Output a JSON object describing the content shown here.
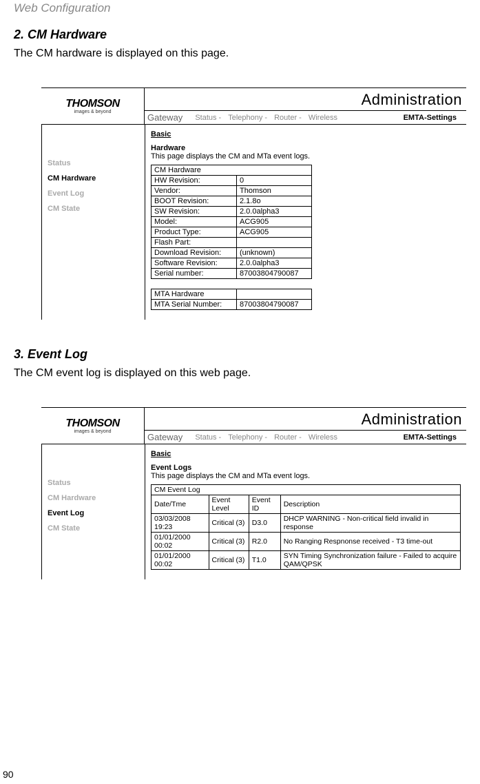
{
  "header": "Web Configuration",
  "page_number": "90",
  "section2": {
    "heading": "2. CM Hardware",
    "text": "The CM hardware is displayed on this page."
  },
  "section3": {
    "heading": "3. Event Log",
    "text": "The CM event log is displayed on this web page."
  },
  "logo": {
    "main": "THOMSON",
    "sub": "images & beyond"
  },
  "admin_title": "Administration",
  "nav": {
    "gateway": "Gateway",
    "status": "Status -",
    "telephony": "Telephony -",
    "router": "Router -",
    "wireless": "Wireless",
    "emta": "EMTA-Settings"
  },
  "side": {
    "status": "Status",
    "cm_hardware": "CM Hardware",
    "event_log": "Event Log",
    "cm_state": "CM State"
  },
  "hw_panel": {
    "basic": "Basic",
    "title": "Hardware",
    "desc": "This page displays the CM and MTa event logs.",
    "table_header": "CM Hardware",
    "rows": [
      {
        "label": "HW Revision:",
        "value": "0"
      },
      {
        "label": "Vendor:",
        "value": "Thomson"
      },
      {
        "label": "BOOT Revision:",
        "value": "2.1.8o"
      },
      {
        "label": "SW Revision:",
        "value": "2.0.0alpha3"
      },
      {
        "label": "Model:",
        "value": "ACG905"
      },
      {
        "label": "Product Type:",
        "value": "ACG905"
      },
      {
        "label": "Flash Part:",
        "value": ""
      },
      {
        "label": "Download Revision:",
        "value": "(unknown)"
      },
      {
        "label": "Software Revision:",
        "value": "2.0.0alpha3"
      },
      {
        "label": "Serial number:",
        "value": "87003804790087"
      }
    ],
    "mta_header": "MTA Hardware",
    "mta_row": {
      "label": "MTA Serial Number:",
      "value": "87003804790087"
    }
  },
  "ev_panel": {
    "basic": "Basic",
    "title": "Event Logs",
    "desc": "This page displays the CM and MTa event logs.",
    "table_header": "CM Event Log",
    "cols": {
      "c1": "Date/Tme",
      "c2": "Event Level",
      "c3": "Event ID",
      "c4": "Description"
    },
    "rows": [
      {
        "c1": "03/03/2008 19:23",
        "c2": "Critical (3)",
        "c3": "D3.0",
        "c4": "DHCP WARNING - Non-critical field invalid in response"
      },
      {
        "c1": "01/01/2000 00:02",
        "c2": "Critical (3)",
        "c3": "R2.0",
        "c4": "No Ranging Respnonse received - T3 time-out"
      },
      {
        "c1": "01/01/2000 00:02",
        "c2": "Critical (3)",
        "c3": "T1.0",
        "c4": "SYN Timing Synchronization failure - Failed to acquire QAM/QPSK"
      }
    ]
  }
}
